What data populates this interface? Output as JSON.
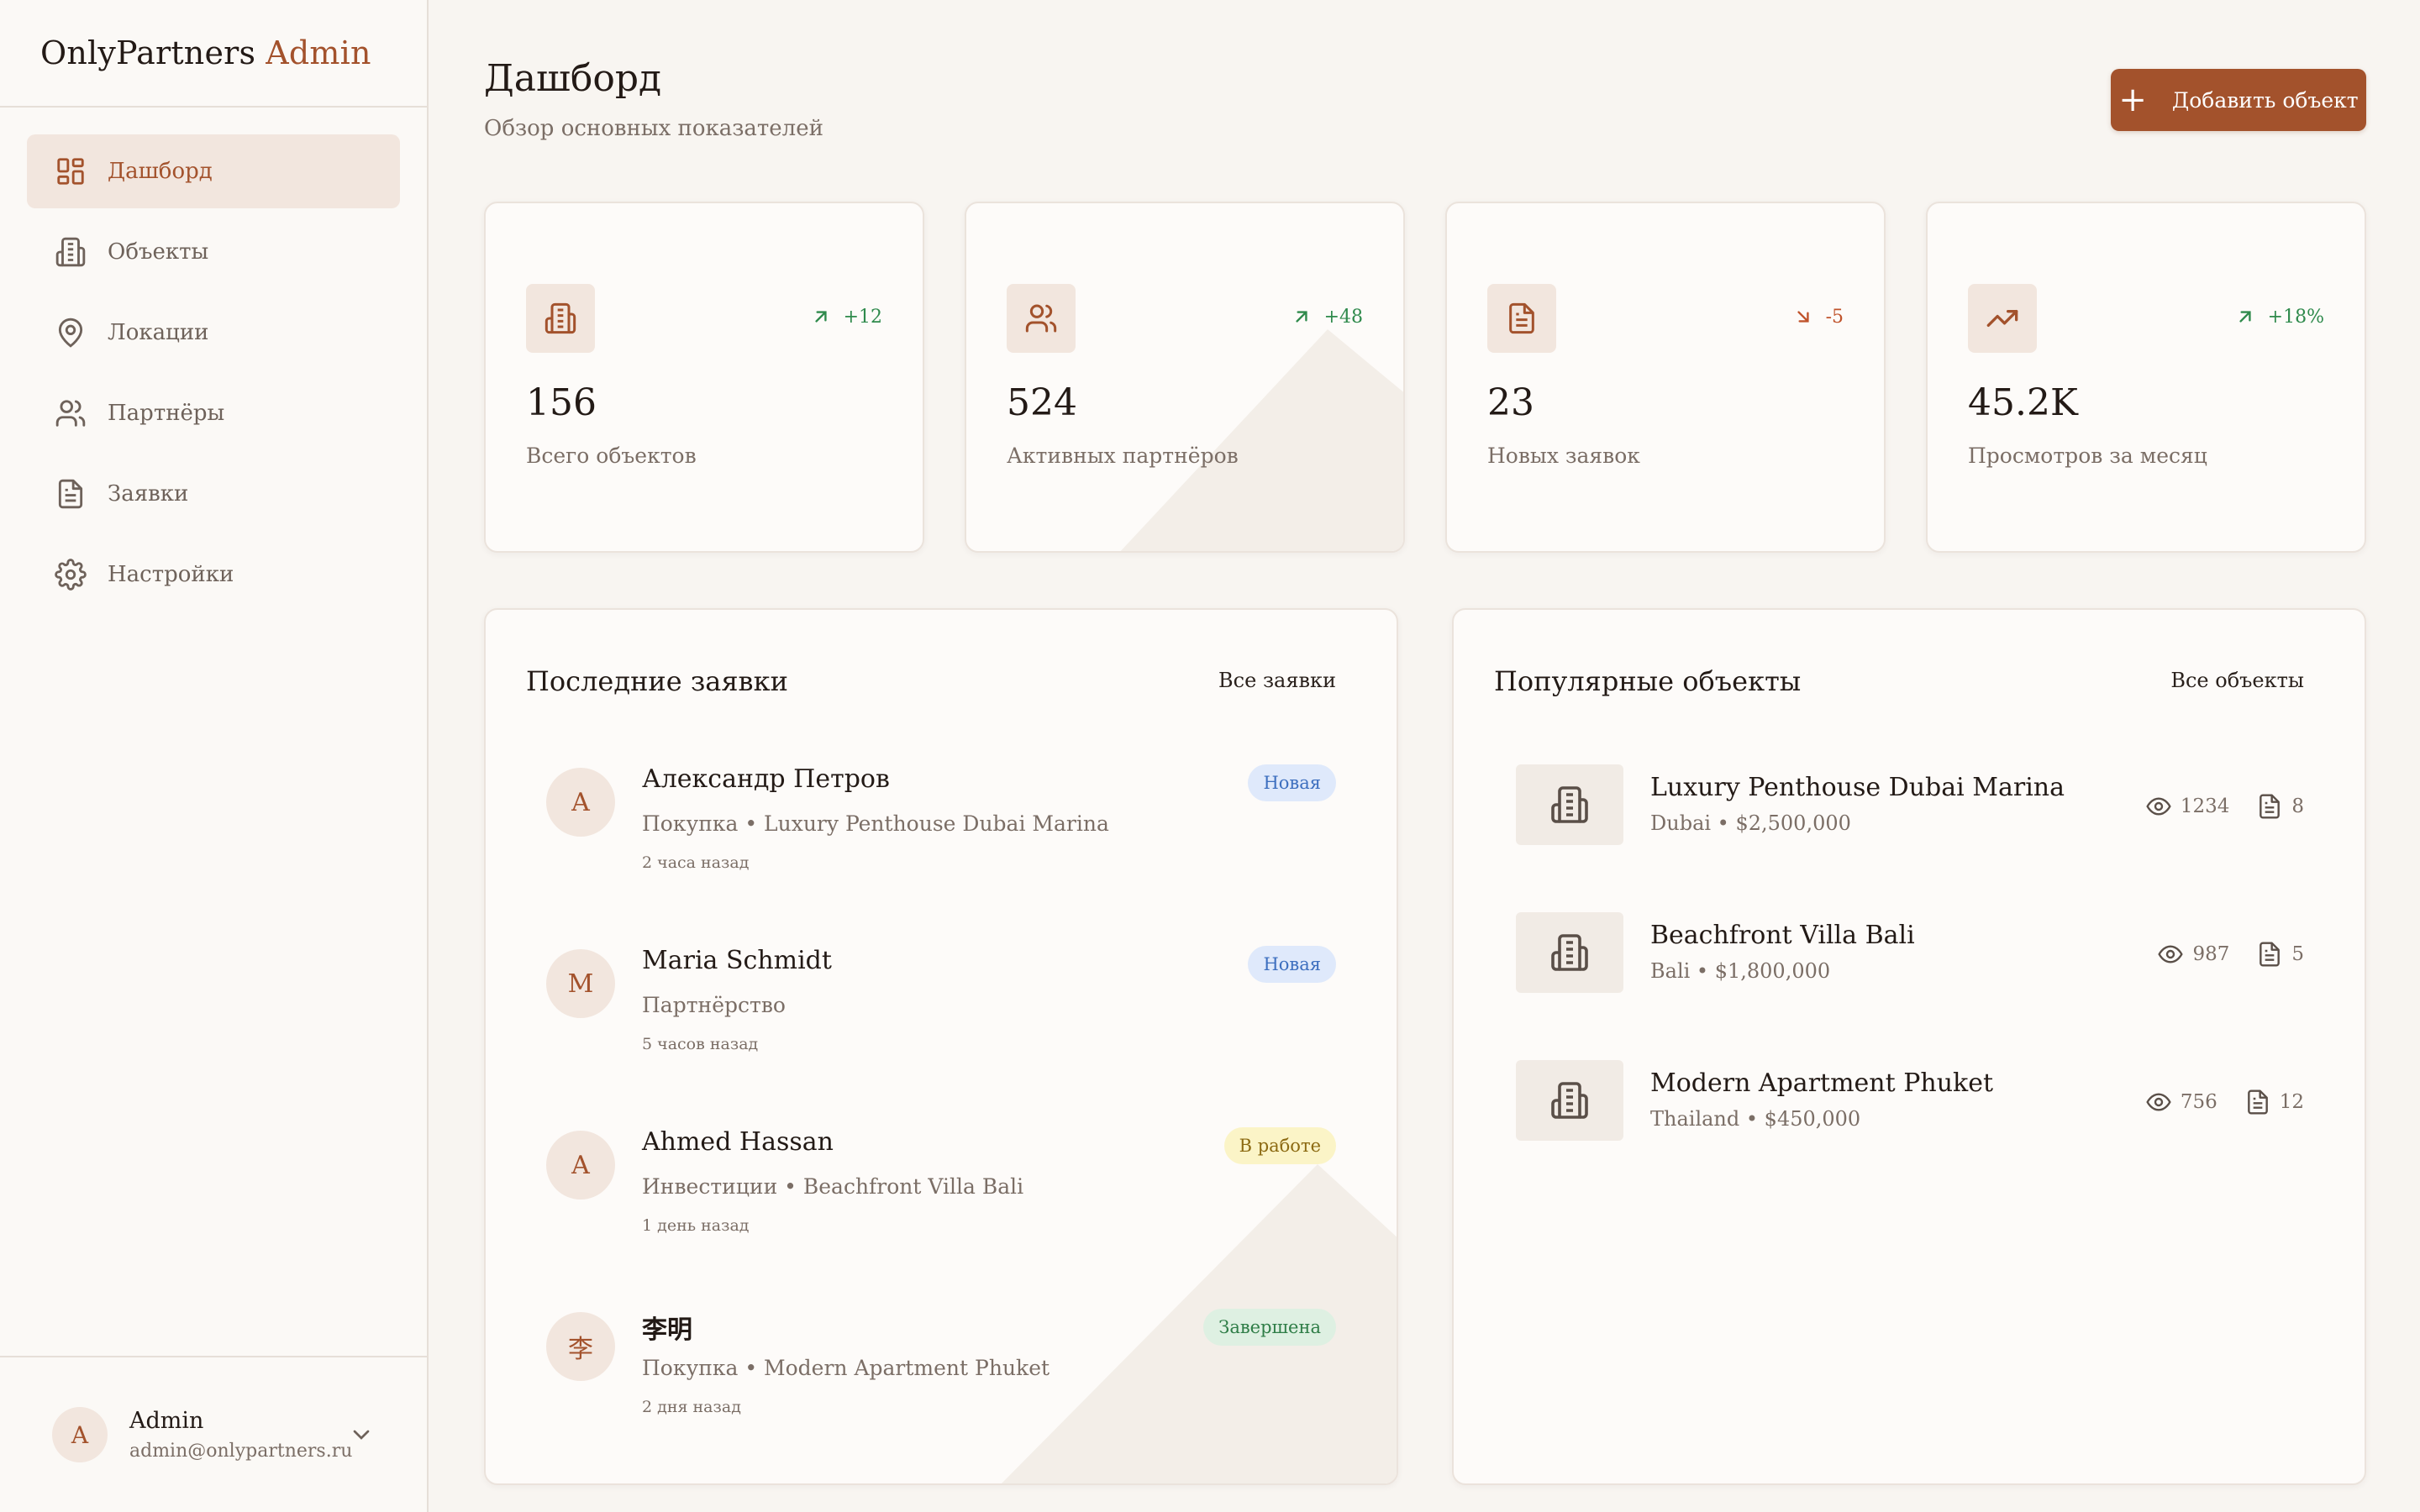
{
  "brand": {
    "name": "OnlyPartners",
    "accent": "Admin"
  },
  "sidebar": {
    "items": [
      {
        "label": "Дашборд",
        "icon": "dashboard-icon",
        "active": true
      },
      {
        "label": "Объекты",
        "icon": "building-icon"
      },
      {
        "label": "Локации",
        "icon": "map-pin-icon"
      },
      {
        "label": "Партнёры",
        "icon": "users-icon"
      },
      {
        "label": "Заявки",
        "icon": "document-icon"
      },
      {
        "label": "Настройки",
        "icon": "gear-icon"
      }
    ],
    "user": {
      "initial": "A",
      "name": "Admin",
      "email": "admin@onlypartners.ru"
    }
  },
  "header": {
    "title": "Дашборд",
    "subtitle": "Обзор основных показателей",
    "add_button": "Добавить объект"
  },
  "stats": [
    {
      "icon": "building-icon",
      "delta": "+12",
      "trend": "up",
      "value": "156",
      "label": "Всего объектов"
    },
    {
      "icon": "users-icon",
      "delta": "+48",
      "trend": "up",
      "value": "524",
      "label": "Активных партнёров"
    },
    {
      "icon": "document-icon",
      "delta": "-5",
      "trend": "down",
      "value": "23",
      "label": "Новых заявок"
    },
    {
      "icon": "trending-up-icon",
      "delta": "+18%",
      "trend": "up",
      "value": "45.2K",
      "label": "Просмотров за месяц"
    }
  ],
  "requests": {
    "title": "Последние заявки",
    "all_link": "Все заявки",
    "items": [
      {
        "initial": "А",
        "name": "Александр Петров",
        "desc": "Покупка • Luxury Penthouse Dubai Marina",
        "time": "2 часа назад",
        "status": "Новая",
        "status_kind": "new"
      },
      {
        "initial": "M",
        "name": "Maria Schmidt",
        "desc": "Партнёрство",
        "time": "5 часов назад",
        "status": "Новая",
        "status_kind": "new"
      },
      {
        "initial": "A",
        "name": "Ahmed Hassan",
        "desc": "Инвестиции • Beachfront Villa Bali",
        "time": "1 день назад",
        "status": "В работе",
        "status_kind": "work"
      },
      {
        "initial": "李",
        "name": "李明",
        "desc": "Покупка • Modern Apartment Phuket",
        "time": "2 дня назад",
        "status": "Завершена",
        "status_kind": "done"
      }
    ]
  },
  "properties": {
    "title": "Популярные объекты",
    "all_link": "Все объекты",
    "items": [
      {
        "name": "Luxury Penthouse Dubai Marina",
        "location": "Dubai • $2,500,000",
        "views": "1234",
        "requests": "8"
      },
      {
        "name": "Beachfront Villa Bali",
        "location": "Bali • $1,800,000",
        "views": "987",
        "requests": "5"
      },
      {
        "name": "Modern Apartment Phuket",
        "location": "Thailand • $450,000",
        "views": "756",
        "requests": "12"
      }
    ]
  },
  "colors": {
    "accent": "#a3522c",
    "background": "#f8f5f1",
    "positive": "#2f8a4c",
    "negative": "#c0532b"
  }
}
